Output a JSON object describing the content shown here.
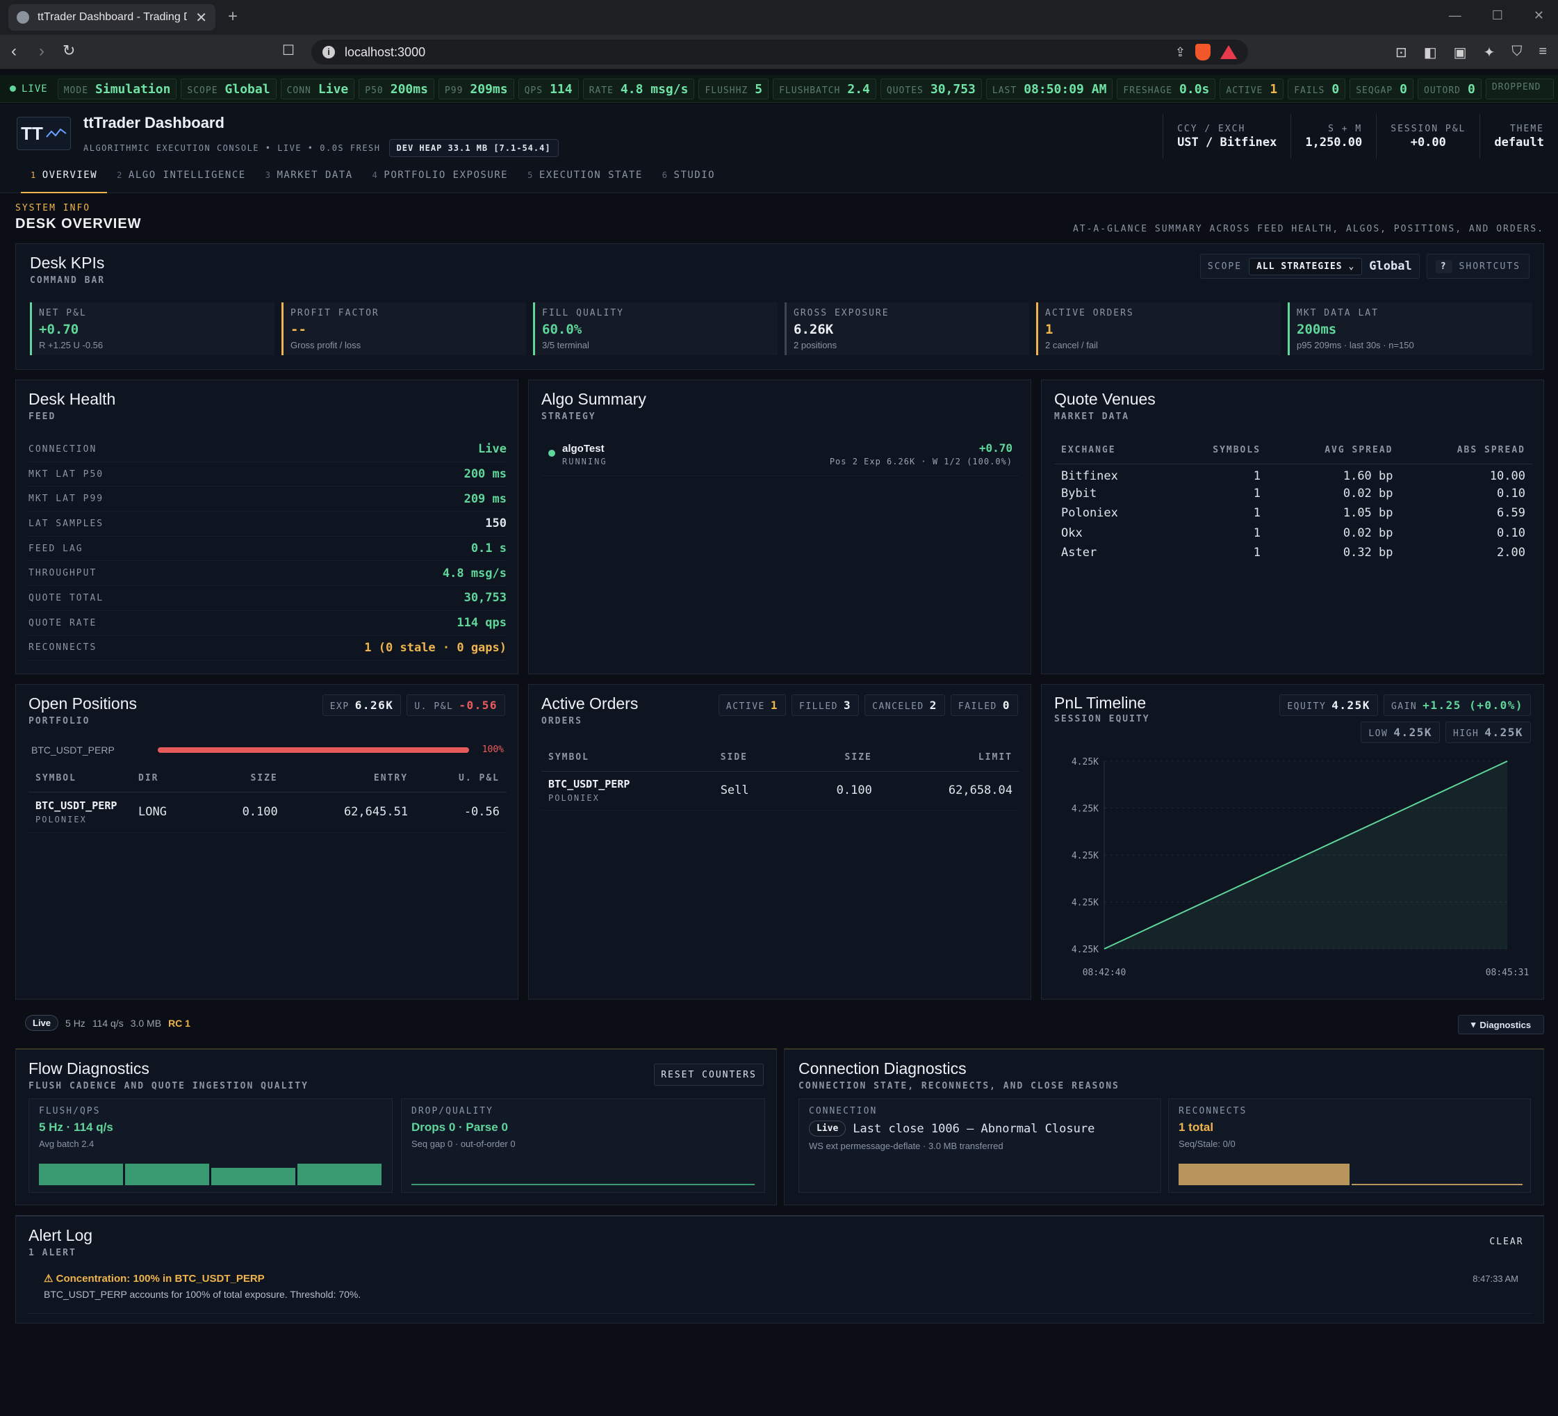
{
  "browser": {
    "tab_title": "ttTrader Dashboard - Trading Da",
    "url": "localhost:3000"
  },
  "status": {
    "live": "LIVE",
    "chips": [
      {
        "k": "MODE",
        "v": "Simulation"
      },
      {
        "k": "SCOPE",
        "v": "Global"
      },
      {
        "k": "CONN",
        "v": "Live"
      },
      {
        "k": "P50",
        "v": "200ms"
      },
      {
        "k": "P99",
        "v": "209ms"
      },
      {
        "k": "QPS",
        "v": "114"
      },
      {
        "k": "RATE",
        "v": "4.8 msg/s"
      },
      {
        "k": "FLUSHHZ",
        "v": "5"
      },
      {
        "k": "FLUSHBATCH",
        "v": "2.4"
      },
      {
        "k": "QUOTES",
        "v": "30,753"
      },
      {
        "k": "LAST",
        "v": "08:50:09 AM"
      },
      {
        "k": "FRESHAGE",
        "v": "0.0s"
      },
      {
        "k": "ACTIVE",
        "v": "1"
      },
      {
        "k": "FAILS",
        "v": "0"
      },
      {
        "k": "SEQGAP",
        "v": "0"
      },
      {
        "k": "OUTORD",
        "v": "0"
      },
      {
        "k": "DROPPEND",
        "v": ""
      }
    ]
  },
  "header": {
    "logo": "TT",
    "title": "ttTrader Dashboard",
    "subtitle": "ALGORITHMIC EXECUTION CONSOLE • LIVE • 0.0S FRESH",
    "heap": "DEV HEAP 33.1 MB [7.1-54.4]",
    "stats": [
      {
        "k": "CCY / EXCH",
        "v": "UST / Bitfinex"
      },
      {
        "k": "S + M",
        "v": "1,250.00"
      },
      {
        "k": "SESSION P&L",
        "v": "+0.00"
      },
      {
        "k": "THEME",
        "v": "default"
      }
    ]
  },
  "tabs": [
    {
      "n": "1",
      "label": "OVERVIEW"
    },
    {
      "n": "2",
      "label": "ALGO INTELLIGENCE"
    },
    {
      "n": "3",
      "label": "MARKET DATA"
    },
    {
      "n": "4",
      "label": "PORTFOLIO EXPOSURE"
    },
    {
      "n": "5",
      "label": "EXECUTION STATE"
    },
    {
      "n": "6",
      "label": "STUDIO"
    }
  ],
  "section": {
    "kicker": "SYSTEM INFO",
    "title": "DESK OVERVIEW",
    "desc": "AT-A-GLANCE SUMMARY ACROSS FEED HEALTH, ALGOS, POSITIONS, AND ORDERS."
  },
  "kpibar": {
    "title": "Desk KPIs",
    "sub": "COMMAND BAR",
    "scope_label": "SCOPE",
    "scope_value": "ALL STRATEGIES",
    "scope_global": "Global",
    "shortcut_key": "?",
    "shortcut_label": "SHORTCUTS",
    "kpis": [
      {
        "k": "NET P&L",
        "v": "+0.70",
        "s": "R +1.25 U -0.56"
      },
      {
        "k": "PROFIT FACTOR",
        "v": "--",
        "s": "Gross profit / loss"
      },
      {
        "k": "FILL QUALITY",
        "v": "60.0%",
        "s": "3/5 terminal"
      },
      {
        "k": "GROSS EXPOSURE",
        "v": "6.26K",
        "s": "2 positions"
      },
      {
        "k": "ACTIVE ORDERS",
        "v": "1",
        "s": "2 cancel / fail"
      },
      {
        "k": "MKT DATA LAT",
        "v": "200ms",
        "s": "p95 209ms · last 30s · n=150"
      }
    ]
  },
  "health": {
    "title": "Desk Health",
    "sub": "FEED",
    "rows": [
      {
        "k": "CONNECTION",
        "v": "Live"
      },
      {
        "k": "MKT LAT P50",
        "v": "200 ms"
      },
      {
        "k": "MKT LAT P99",
        "v": "209 ms"
      },
      {
        "k": "LAT SAMPLES",
        "v": "150"
      },
      {
        "k": "FEED LAG",
        "v": "0.1 s"
      },
      {
        "k": "THROUGHPUT",
        "v": "4.8 msg/s"
      },
      {
        "k": "QUOTE TOTAL",
        "v": "30,753"
      },
      {
        "k": "QUOTE RATE",
        "v": "114 qps"
      },
      {
        "k": "RECONNECTS",
        "v": "1 (0 stale · 0 gaps)"
      }
    ]
  },
  "algo": {
    "title": "Algo Summary",
    "sub": "STRATEGY",
    "name": "algoTest",
    "state": "RUNNING",
    "pnl": "+0.70",
    "detail": "Pos 2 Exp 6.26K · W 1/2 (100.0%)"
  },
  "venues": {
    "title": "Quote Venues",
    "sub": "MARKET DATA",
    "cols": [
      "EXCHANGE",
      "SYMBOLS",
      "AVG SPREAD",
      "ABS SPREAD"
    ],
    "rows": [
      [
        "Bitfinex",
        "1",
        "1.60 bp",
        "10.00"
      ],
      [
        "Bybit",
        "1",
        "0.02 bp",
        "0.10"
      ],
      [
        "Poloniex",
        "1",
        "1.05 bp",
        "6.59"
      ],
      [
        "Okx",
        "1",
        "0.02 bp",
        "0.10"
      ],
      [
        "Aster",
        "1",
        "0.32 bp",
        "2.00"
      ]
    ]
  },
  "positions": {
    "title": "Open Positions",
    "sub": "PORTFOLIO",
    "exp_k": "EXP",
    "exp_v": "6.26K",
    "upnl_k": "U. P&L",
    "upnl_v": "-0.56",
    "conc_symbol": "BTC_USDT_PERP",
    "conc_pct": "100%",
    "conc_fraction": 1.0,
    "cols": [
      "SYMBOL",
      "DIR",
      "SIZE",
      "ENTRY",
      "U. P&L"
    ],
    "row": {
      "symbol": "BTC_USDT_PERP",
      "venue": "POLONIEX",
      "dir": "LONG",
      "size": "0.100",
      "entry": "62,645.51",
      "upnl": "-0.56"
    }
  },
  "orders": {
    "title": "Active Orders",
    "sub": "ORDERS",
    "chips": [
      {
        "k": "ACTIVE",
        "v": "1"
      },
      {
        "k": "FILLED",
        "v": "3"
      },
      {
        "k": "CANCELED",
        "v": "2"
      },
      {
        "k": "FAILED",
        "v": "0"
      }
    ],
    "cols": [
      "SYMBOL",
      "SIDE",
      "SIZE",
      "LIMIT"
    ],
    "row": {
      "symbol": "BTC_USDT_PERP",
      "venue": "POLONIEX",
      "side": "Sell",
      "size": "0.100",
      "limit": "62,658.04"
    }
  },
  "pnl": {
    "title": "PnL Timeline",
    "sub": "SESSION EQUITY",
    "equity_k": "EQUITY",
    "equity_v": "4.25K",
    "gain_k": "GAIN",
    "gain_v": "+1.25 (+0.0%)",
    "low_k": "LOW",
    "low_v": "4.25K",
    "high_k": "HIGH",
    "high_v": "4.25K"
  },
  "chart_data": {
    "type": "line",
    "yticks": [
      "4.25K",
      "4.25K",
      "4.25K",
      "4.25K",
      "4.25K"
    ],
    "x": [
      "08:42:40",
      "08:45:31"
    ],
    "values": [
      0,
      1
    ],
    "color": "#5fd69a"
  },
  "footer": {
    "pill": "Live",
    "hz": "5 Hz",
    "qps": "114 q/s",
    "mb": "3.0 MB",
    "rc": "RC 1",
    "diag": "Diagnostics"
  },
  "flow": {
    "title": "Flow Diagnostics",
    "sub": "FLUSH CADENCE AND QUOTE INGESTION QUALITY",
    "reset": "RESET COUNTERS",
    "c1": {
      "k": "FLUSH/QPS",
      "v": "5 Hz · 114 q/s",
      "s": "Avg batch 2.4"
    },
    "c2": {
      "k": "DROP/QUALITY",
      "v": "Drops 0 · Parse 0",
      "s": "Seq gap 0 · out-of-order 0"
    }
  },
  "conn": {
    "title": "Connection Diagnostics",
    "sub": "CONNECTION STATE, RECONNECTS, AND CLOSE REASONS",
    "c1": {
      "k": "CONNECTION",
      "pill": "Live",
      "v": "Last close 1006 — Abnormal Closure",
      "s": "WS ext permessage-deflate · 3.0 MB transferred"
    },
    "c2": {
      "k": "RECONNECTS",
      "v": "1 total",
      "s": "Seq/Stale: 0/0"
    }
  },
  "alerts": {
    "title": "Alert Log",
    "sub": "1 ALERT",
    "clear": "CLEAR",
    "item": {
      "title": "Concentration: 100% in BTC_USDT_PERP",
      "body": "BTC_USDT_PERP accounts for 100% of total exposure. Threshold: 70%.",
      "time": "8:47:33 AM"
    }
  },
  "colors": {
    "accent": "#f0b44c",
    "positive": "#5fd69a",
    "negative": "#ef5b5b",
    "bg": "#0b0e14"
  }
}
